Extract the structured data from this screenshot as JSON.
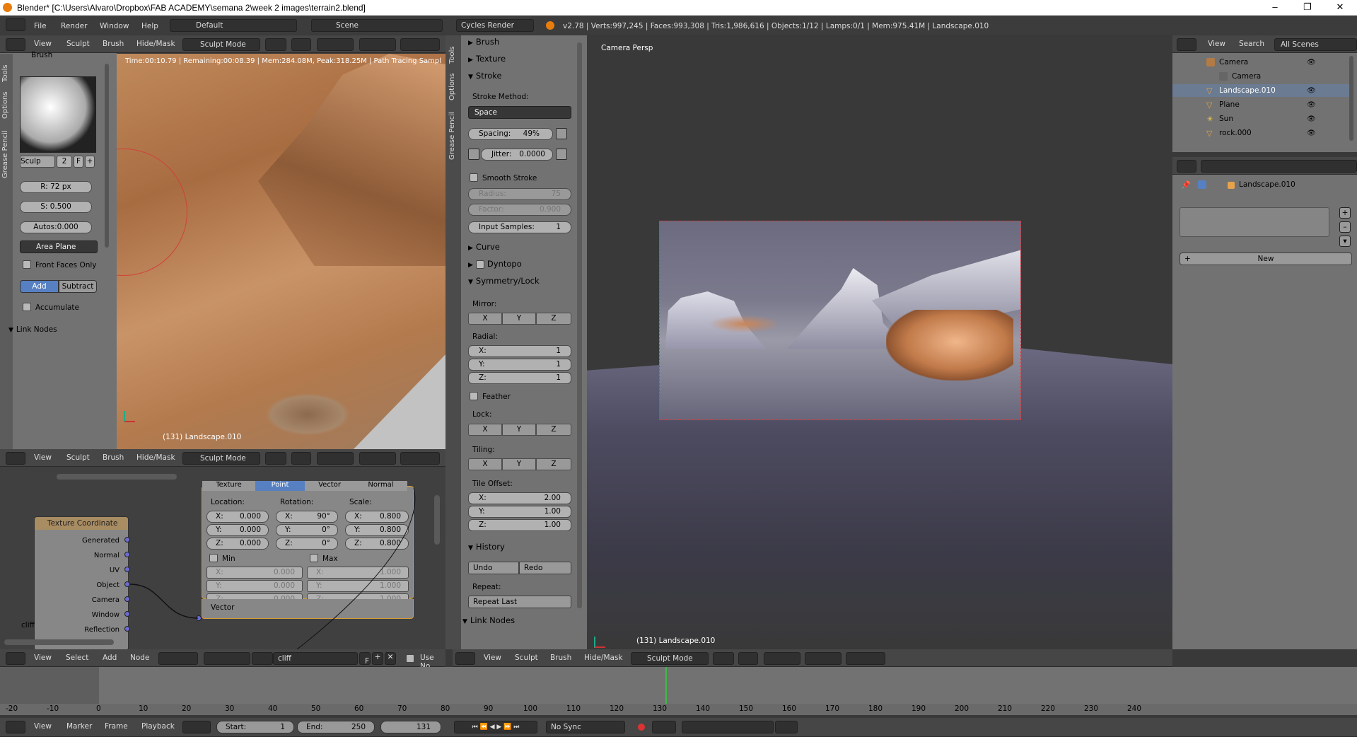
{
  "window": {
    "title": "Blender* [C:\\Users\\Alvaro\\Dropbox\\FAB ACADEMY\\semana 2\\week 2 images\\terrain2.blend]",
    "minimize": "–",
    "maximize": "❐",
    "close": "✕"
  },
  "infobar": {
    "menus": [
      "File",
      "Render",
      "Window",
      "Help"
    ],
    "layout": "Default",
    "scene": "Scene",
    "engine": "Cycles Render",
    "stats": "v2.78 | Verts:997,245 | Faces:993,308 | Tris:1,986,616 | Objects:1/12 | Lamps:0/1 | Mem:975.41M | Landscape.010"
  },
  "viewport_header": {
    "menus": [
      "View",
      "Sculpt",
      "Brush",
      "Hide/Mask"
    ],
    "mode": "Sculpt Mode"
  },
  "left_tools": {
    "tabs": [
      "Tools",
      "Options",
      "Grease Pencil"
    ],
    "brush_label": "Brush",
    "brush_name": "Sculp",
    "brush_users": "2",
    "brush_fake": "F",
    "radius": "R: 72 px",
    "strength": "S: 0.500",
    "autosmooth": "Autos:0.000",
    "plane": "Area Plane",
    "front_faces": "Front Faces Only",
    "add": "Add",
    "subtract": "Subtract",
    "accumulate": "Accumulate",
    "link_nodes": "Link Nodes"
  },
  "render_view": {
    "status": "Time:00:10.79 | Remaining:00:08.39 | Mem:284.08M, Peak:318.25M | Path Tracing Sampl",
    "object": "(131) Landscape.010"
  },
  "node_editor": {
    "tabs": [
      "Texture",
      "Point",
      "Vector",
      "Normal"
    ],
    "location_label": "Location:",
    "rotation_label": "Rotation:",
    "scale_label": "Scale:",
    "loc": [
      "X:",
      "0.000",
      "Y:",
      "0.000",
      "Z:",
      "0.000"
    ],
    "rot": [
      "X:",
      "90°",
      "Y:",
      "0°",
      "Z:",
      "0°"
    ],
    "scl": [
      "X:",
      "0.800",
      "Y:",
      "0.800",
      "Z:",
      "0.800"
    ],
    "min": "Min",
    "max": "Max",
    "min_vals": [
      "X:",
      "0.000",
      "Y:",
      "0.000",
      "Z:",
      "0.000"
    ],
    "max_vals": [
      "X:",
      "1.000",
      "Y:",
      "1.000",
      "Z:",
      "1.000"
    ],
    "vector": "Vector",
    "texcoord_title": "Texture Coordinate",
    "outputs": [
      "Generated",
      "Normal",
      "UV",
      "Object",
      "Camera",
      "Window",
      "Reflection"
    ],
    "mat_label": "cliff"
  },
  "node_header": {
    "menus": [
      "View",
      "Select",
      "Add",
      "Node"
    ],
    "material": "cliff",
    "fake": "F",
    "use_nodes": "Use No"
  },
  "tool_shelf": {
    "tabs": [
      "Tools",
      "Options",
      "Grease Pencil"
    ],
    "brush": "Brush",
    "texture": "Texture",
    "stroke": "Stroke",
    "stroke_method": "Stroke Method:",
    "method": "Space",
    "spacing": "Spacing:",
    "spacing_val": "49%",
    "jitter": "Jitter:",
    "jitter_val": "0.0000",
    "smooth": "Smooth Stroke",
    "radius": "Radius:",
    "radius_val": "75",
    "factor": "Factor:",
    "factor_val": "0.900",
    "input_samples": "Input Samples:",
    "input_samples_val": "1",
    "curve": "Curve",
    "dyntopo": "Dyntopo",
    "symmetry": "Symmetry/Lock",
    "mirror": "Mirror:",
    "radial": "Radial:",
    "x": "X",
    "y": "Y",
    "z": "Z",
    "rx": "X:",
    "ry": "Y:",
    "rz": "Z:",
    "one": "1",
    "feather": "Feather",
    "lock": "Lock:",
    "tiling": "Tiling:",
    "tile_offset": "Tile Offset:",
    "to_x": "2.00",
    "to_y": "1.00",
    "to_z": "1.00",
    "history": "History",
    "undo": "Undo",
    "redo": "Redo",
    "repeat": "Repeat:",
    "repeat_last": "Repeat Last",
    "link_nodes": "Link Nodes"
  },
  "viewport3d": {
    "label": "Camera Persp",
    "object": "(131) Landscape.010"
  },
  "outliner": {
    "menus": [
      "View",
      "Search"
    ],
    "scenes": "All Scenes",
    "items": [
      "Camera",
      "Camera",
      "Landscape.010",
      "Plane",
      "Sun",
      "rock.000"
    ]
  },
  "properties": {
    "breadcrumb": "Landscape.010",
    "new": "New"
  },
  "timeline": {
    "ticks": [
      "-20",
      "-10",
      "0",
      "10",
      "20",
      "30",
      "40",
      "50",
      "60",
      "70",
      "80",
      "90",
      "100",
      "110",
      "120",
      "130",
      "140",
      "150",
      "160",
      "170",
      "180",
      "190",
      "200",
      "210",
      "220",
      "230",
      "240"
    ],
    "menus": [
      "View",
      "Marker",
      "Frame",
      "Playback"
    ],
    "start": "Start:",
    "start_val": "1",
    "end": "End:",
    "end_val": "250",
    "current": "131",
    "sync": "No Sync"
  },
  "colors": {
    "accent": "#5680c2",
    "panel": "#727272",
    "terrain": "#b98357"
  }
}
